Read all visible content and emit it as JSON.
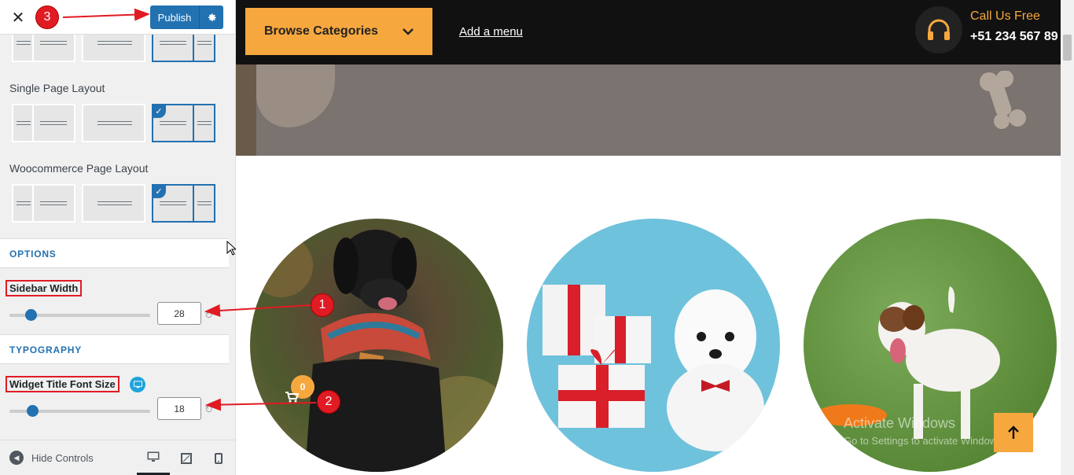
{
  "header": {
    "close_label": "✕",
    "publish_label": "Publish",
    "gear_icon": "gear-icon"
  },
  "sections": {
    "single_page_layout": "Single Page Layout",
    "woocommerce_page_layout": "Woocommerce Page Layout",
    "options": "OPTIONS",
    "typography": "TYPOGRAPHY"
  },
  "controls": {
    "sidebar_width_label": "Sidebar Width",
    "sidebar_width_value": "28",
    "widget_title_font_size_label": "Widget Title Font Size",
    "widget_title_font_size_value": "18"
  },
  "footer": {
    "hide_controls": "Hide Controls"
  },
  "annotations": {
    "one": "1",
    "two": "2",
    "three": "3"
  },
  "preview": {
    "browse_categories": "Browse Categories",
    "add_menu": "Add a menu",
    "call_us_free": "Call Us Free",
    "phone": "+51 234 567 89",
    "cart_count": "0",
    "watermark_title": "Activate Windows",
    "watermark_sub": "Go to Settings to activate Windows."
  },
  "colors": {
    "accent": "#2271b1",
    "brand_orange": "#f6a83f",
    "annotation_red": "#e01b24",
    "topbar": "#111111"
  }
}
